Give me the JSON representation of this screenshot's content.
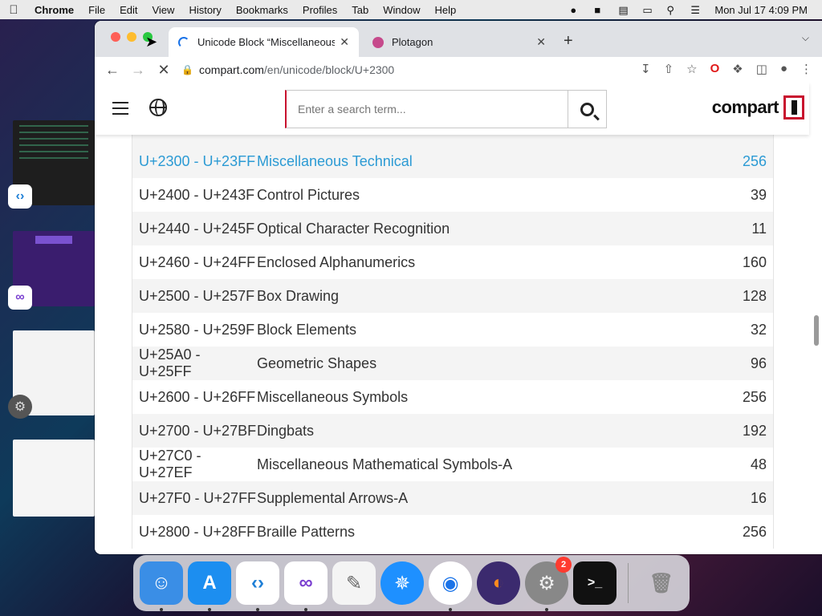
{
  "menubar": {
    "app_name": "Chrome",
    "items": [
      "File",
      "Edit",
      "View",
      "History",
      "Bookmarks",
      "Profiles",
      "Tab",
      "Window",
      "Help"
    ],
    "clock": "Mon Jul 17  4:09 PM"
  },
  "tabs": [
    {
      "title": "Unicode Block “Miscellaneous",
      "state": "loading"
    },
    {
      "title": "Plotagon",
      "state": "inactive"
    }
  ],
  "omnibox": {
    "host": "compart.com",
    "path": "/en/unicode/block/U+2300"
  },
  "site": {
    "search_placeholder": "Enter a search term...",
    "logo_text": "compart"
  },
  "blocks": [
    {
      "range": "U+2300 - U+23FF",
      "name": "Miscellaneous Technical",
      "count": "256",
      "highlight": true
    },
    {
      "range": "U+2400 - U+243F",
      "name": "Control Pictures",
      "count": "39"
    },
    {
      "range": "U+2440 - U+245F",
      "name": "Optical Character Recognition",
      "count": "11"
    },
    {
      "range": "U+2460 - U+24FF",
      "name": "Enclosed Alphanumerics",
      "count": "160"
    },
    {
      "range": "U+2500 - U+257F",
      "name": "Box Drawing",
      "count": "128"
    },
    {
      "range": "U+2580 - U+259F",
      "name": "Block Elements",
      "count": "32"
    },
    {
      "range": "U+25A0 - U+25FF",
      "name": "Geometric Shapes",
      "count": "96"
    },
    {
      "range": "U+2600 - U+26FF",
      "name": "Miscellaneous Symbols",
      "count": "256"
    },
    {
      "range": "U+2700 - U+27BF",
      "name": "Dingbats",
      "count": "192"
    },
    {
      "range": "U+27C0 - U+27EF",
      "name": "Miscellaneous Mathematical Symbols-A",
      "count": "48"
    },
    {
      "range": "U+27F0 - U+27FF",
      "name": "Supplemental Arrows-A",
      "count": "16"
    },
    {
      "range": "U+2800 - U+28FF",
      "name": "Braille Patterns",
      "count": "256"
    }
  ],
  "dock": {
    "apps": [
      {
        "icon": "finder-icon",
        "glyph": "☺",
        "bg": "#3a8ee6"
      },
      {
        "icon": "app-store-icon",
        "glyph": "A",
        "bg": "#1c8ef0"
      },
      {
        "icon": "vscode-icon",
        "glyph": "‹›",
        "bg": "#ffffff"
      },
      {
        "icon": "visual-studio-icon",
        "glyph": "∞",
        "bg": "#ffffff"
      },
      {
        "icon": "textedit-icon",
        "glyph": "✎",
        "bg": "#f4f4f4"
      },
      {
        "icon": "safari-icon",
        "glyph": "✵",
        "bg": "#1e90ff"
      },
      {
        "icon": "chrome-icon",
        "glyph": "◉",
        "bg": "#ffffff"
      },
      {
        "icon": "firefox-icon",
        "glyph": "◐",
        "bg": "#3b2a6e"
      },
      {
        "icon": "system-settings-icon",
        "glyph": "⚙",
        "bg": "#888888",
        "badge": "2"
      },
      {
        "icon": "terminal-icon",
        "glyph": ">_",
        "bg": "#111111"
      }
    ],
    "trash": {
      "icon": "trash-icon",
      "glyph": "🗑"
    }
  }
}
